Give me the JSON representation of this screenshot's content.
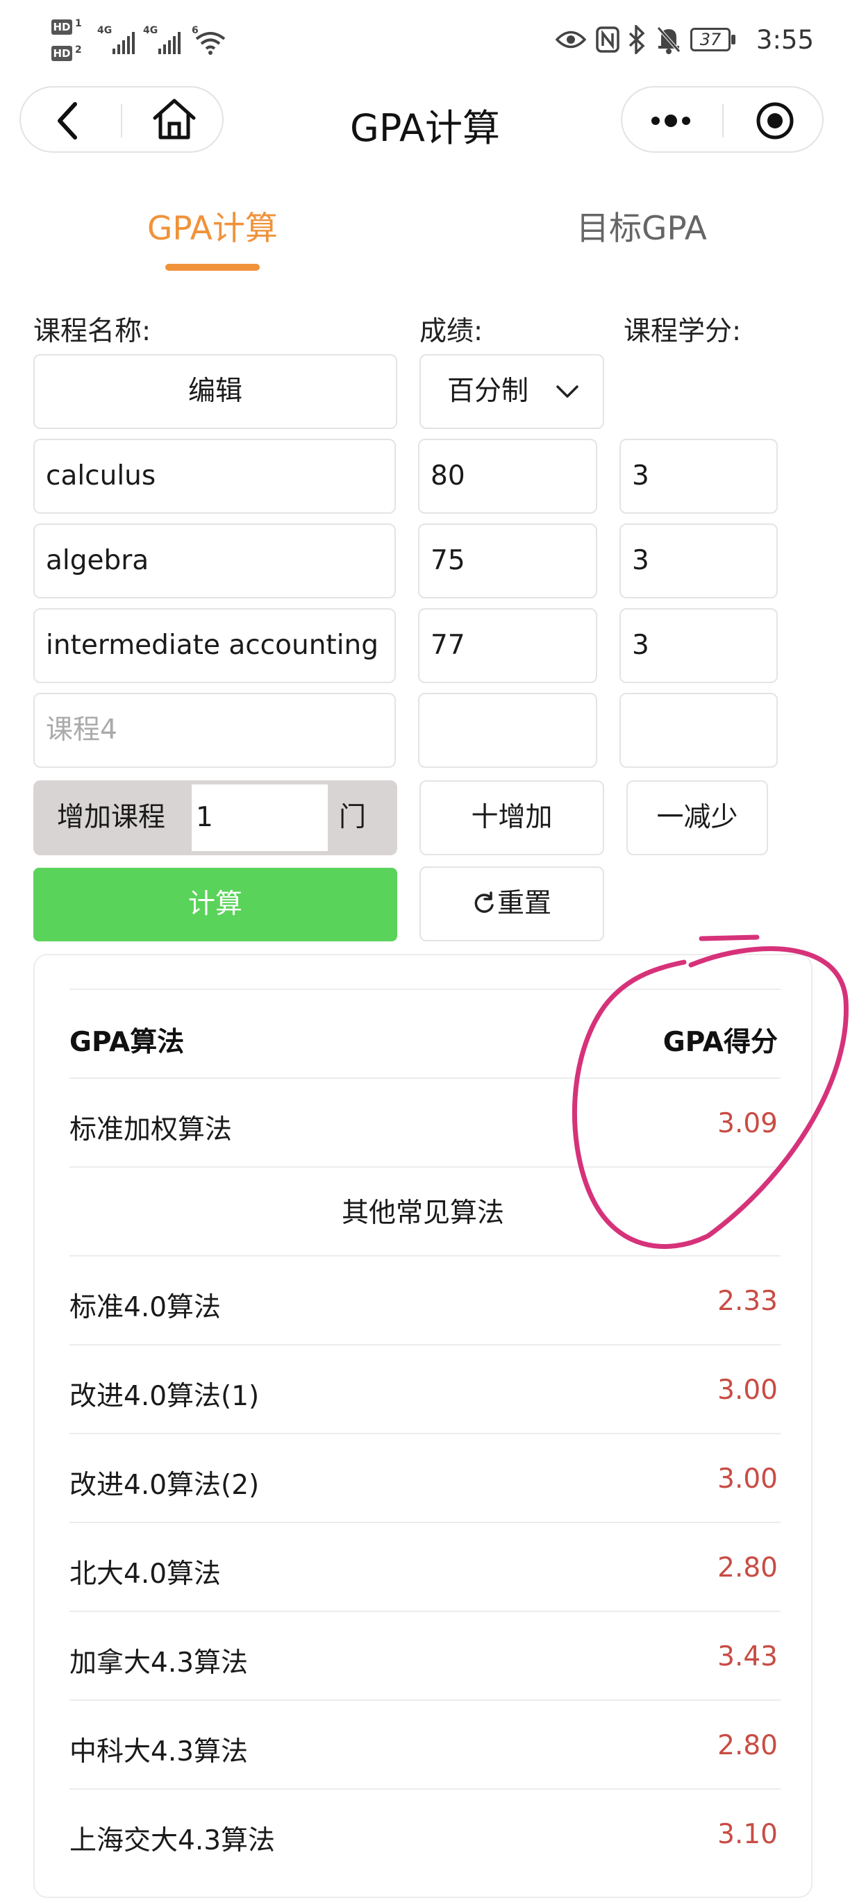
{
  "status_bar": {
    "time": "3:55",
    "battery": "37",
    "sim1_badge": "HD",
    "sim1_num": "1",
    "sim2_badge": "HD",
    "sim2_num": "2",
    "network1": "4G",
    "network2": "4G",
    "wifi_label": "6",
    "icons": [
      "eye-icon",
      "nfc-icon",
      "bluetooth-icon",
      "mute-bell-icon",
      "battery-icon"
    ]
  },
  "nav": {
    "title": "GPA计算",
    "back_icon": "chevron-left-icon",
    "home_icon": "home-icon",
    "more_icon": "more-dots-icon",
    "close_icon": "target-circle-icon"
  },
  "tabs": [
    {
      "label": "GPA计算",
      "active": true
    },
    {
      "label": "目标GPA",
      "active": false
    }
  ],
  "form": {
    "headers": {
      "course": "课程名称:",
      "grade": "成绩:",
      "credit": "课程学分:"
    },
    "edit_label": "编辑",
    "grade_scale": "百分制",
    "courses": [
      {
        "name": "calculus",
        "grade": "80",
        "credit": "3"
      },
      {
        "name": "algebra",
        "grade": "75",
        "credit": "3"
      },
      {
        "name": "intermediate accounting",
        "grade": "77",
        "credit": "3"
      }
    ],
    "placeholder_row": {
      "name_placeholder": "课程4",
      "grade": "",
      "credit": ""
    },
    "add_course_label": "增加课程",
    "add_course_count": "1",
    "add_course_unit": "门",
    "add_button": "十增加",
    "reduce_button": "一减少",
    "calculate_button": "计算",
    "reset_button": "重置"
  },
  "results": {
    "col_method": "GPA算法",
    "col_score": "GPA得分",
    "primary": {
      "method": "标准加权算法",
      "score": "3.09"
    },
    "other_heading": "其他常见算法",
    "others": [
      {
        "method": "标准4.0算法",
        "score": "2.33"
      },
      {
        "method": "改进4.0算法(1)",
        "score": "3.00"
      },
      {
        "method": "改进4.0算法(2)",
        "score": "3.00"
      },
      {
        "method": "北大4.0算法",
        "score": "2.80"
      },
      {
        "method": "加拿大4.3算法",
        "score": "3.43"
      },
      {
        "method": "中科大4.3算法",
        "score": "2.80"
      },
      {
        "method": "上海交大4.3算法",
        "score": "3.10"
      }
    ]
  },
  "colors": {
    "accent": "#f0923a",
    "calculate_green": "#5ad35a",
    "score_red": "#c84c44",
    "annotation_pink": "#d6327a"
  }
}
